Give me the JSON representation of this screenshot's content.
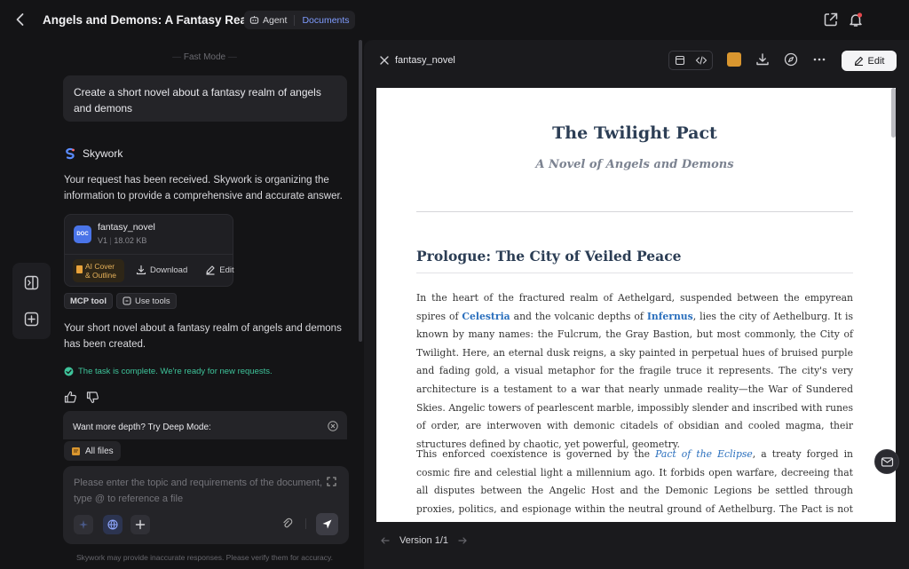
{
  "header": {
    "title": "Angels and Demons: A Fantasy Realm",
    "agent_label": "Agent",
    "documents_label": "Documents"
  },
  "chat": {
    "mode_label": "Fast Mode",
    "user_message": "Create a short novel about a fantasy realm of angels and demons",
    "assistant_name": "Skywork",
    "response_intro": "Your request has been received. Skywork is organizing the information to provide a comprehensive and accurate answer.",
    "file_card": {
      "icon_text": "DOC",
      "name": "fantasy_novel",
      "version": "V1",
      "size": "18.02 KB",
      "ai_cover_label": "AI Cover & Outline",
      "download_label": "Download",
      "edit_label": "Edit"
    },
    "tools": {
      "mcp_label": "MCP tool",
      "use_tools_label": "Use tools"
    },
    "response_result": "Your short novel about a fantasy realm of angels and demons has been created.",
    "task_status": "The task is complete. We're ready for new requests.",
    "deep_mode_prompt": "Want more depth? Try Deep Mode:",
    "all_files_label": "All files",
    "input_placeholder": "Please enter the topic and requirements of the document, type @ to reference a file",
    "disclaimer": "Skywork may provide inaccurate responses. Please verify them for accuracy."
  },
  "document": {
    "filename": "fantasy_novel",
    "edit_label": "Edit",
    "version_label": "Version 1/1",
    "title": "The Twilight Pact",
    "subtitle": "A Novel of Angels and Demons",
    "heading": "Prologue: The City of Veiled Peace",
    "p1_a": "In the heart of the fractured realm of Aethelgard, suspended between the empyrean spires of ",
    "p1_celestria": "Celestria",
    "p1_b": " and the volcanic depths of ",
    "p1_infernus": "Infernus",
    "p1_c": ", lies the city of Aethelburg. It is known by many names: the Fulcrum, the Gray Bastion, but most commonly, the City of Twilight. Here, an eternal dusk reigns, a sky painted in perpetual hues of bruised purple and fading gold, a visual metaphor for the fragile truce it represents. The city's very architecture is a testament to a war that nearly unmade reality—the War of Sundered Skies. Angelic towers of pearlescent marble, impossibly slender and inscribed with runes of order, are interwoven with demonic citadels of obsidian and cooled magma, their structures defined by chaotic, yet powerful, geometry.",
    "p2_a": "This enforced coexistence is governed by the ",
    "p2_pact": "Pact of the Eclipse",
    "p2_b": ", a treaty forged in cosmic fire and celestial light a millennium ago. It forbids open warfare, decreeing that all disputes between the Angelic Host and the Demonic Legions be settled through proxies, politics, and espionage within the neutral ground of Aethelburg. The Pact is not a symbol of friendship, but a cage built from"
  },
  "colors": {
    "background": "#141416",
    "panel": "#1a1a1d",
    "accent_blue": "#7f9cff",
    "success_green": "#3ec39a",
    "doc_heading": "#2c3e55",
    "doc_link": "#2a6fbd"
  },
  "icons": {
    "back": "chevron-left-icon",
    "share": "share-icon",
    "notifications": "bell-icon",
    "sidebar_toggle": "sidebar-toggle-icon",
    "new_chat": "plus-square-icon",
    "close": "close-icon",
    "download": "download-icon",
    "compass": "compass-icon",
    "more": "more-icon",
    "send": "send-icon"
  }
}
